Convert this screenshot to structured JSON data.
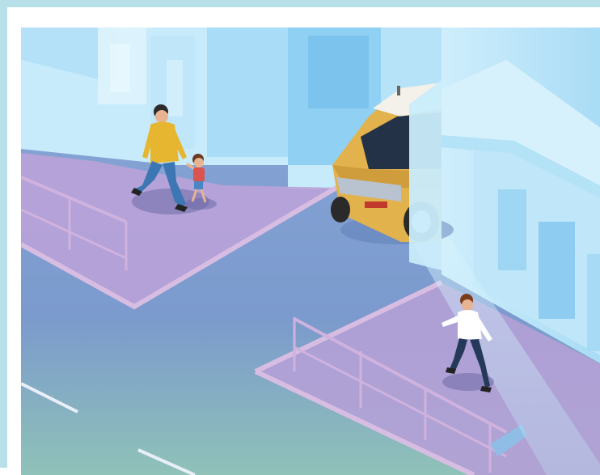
{
  "scene": {
    "colors": {
      "frame": "#b8e0e8",
      "building_light": "#cfeefc",
      "building_mid": "#9fd8f5",
      "building_dark": "#7cc4ee",
      "road": "#7f9fd2",
      "road_light": "#a9c4e8",
      "detection_zone": "#b9a2d8",
      "sidewalk_edge": "#d4b7df",
      "car_body": "#e2b24c",
      "car_roof": "#f4f1ea",
      "sensor_beam": "#c6ecfb",
      "lane_marking": "#e8eff9",
      "bottom_tint": "#8fc2b8"
    },
    "icons": {
      "father": "adult-walking-icon",
      "child": "child-walking-icon",
      "pedestrian": "pedestrian-walking-icon",
      "vehicle": "mini-car-icon"
    }
  }
}
